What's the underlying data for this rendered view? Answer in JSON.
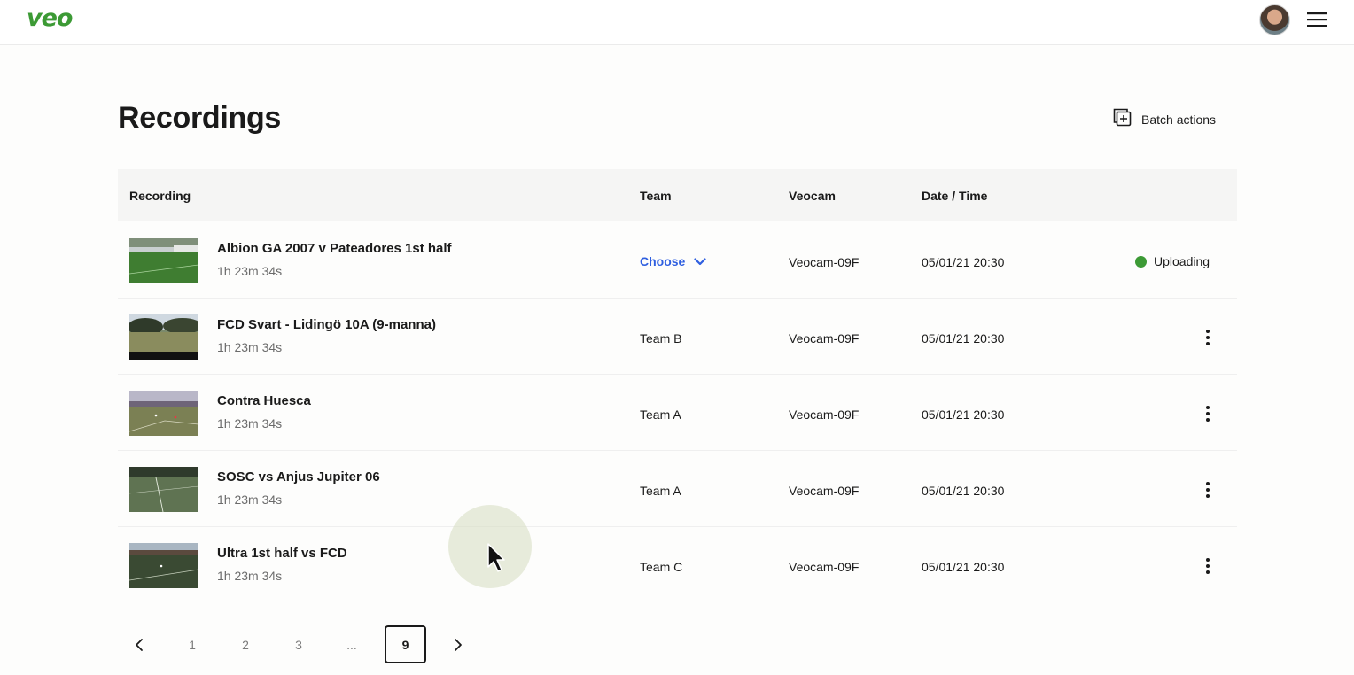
{
  "header": {
    "logo_text": "veo",
    "brand_color": "#3c9a35",
    "avatar_icon": "user-avatar",
    "menu_icon": "hamburger-menu-icon"
  },
  "page": {
    "title": "Recordings",
    "batch_actions_label": "Batch actions",
    "batch_icon": "batch-add-icon"
  },
  "table": {
    "columns": {
      "recording": "Recording",
      "team": "Team",
      "veocam": "Veocam",
      "datetime": "Date / Time"
    },
    "rows": [
      {
        "title": "Albion GA 2007 v Pateadores 1st half",
        "duration": "1h 23m 34s",
        "team": "Choose",
        "team_is_choose": true,
        "veocam": "Veocam-09F",
        "datetime": "05/01/21 20:30",
        "status": "Uploading",
        "status_color": "#3c9a35"
      },
      {
        "title": "FCD Svart - Lidingö 10A (9-manna)",
        "duration": "1h 23m 34s",
        "team": "Team B",
        "veocam": "Veocam-09F",
        "datetime": "05/01/21 20:30"
      },
      {
        "title": "Contra Huesca",
        "duration": "1h 23m 34s",
        "team": "Team A",
        "veocam": "Veocam-09F",
        "datetime": "05/01/21 20:30"
      },
      {
        "title": "SOSC vs Anjus Jupiter 06",
        "duration": "1h 23m 34s",
        "team": "Team A",
        "veocam": "Veocam-09F",
        "datetime": "05/01/21 20:30"
      },
      {
        "title": "Ultra 1st half vs FCD",
        "duration": "1h 23m 34s",
        "team": "Team C",
        "veocam": "Veocam-09F",
        "datetime": "05/01/21 20:30"
      }
    ]
  },
  "pagination": {
    "pages": [
      "1",
      "2",
      "3",
      "...",
      "9"
    ],
    "current": "9",
    "prev_icon": "chevron-left-icon",
    "next_icon": "chevron-right-icon"
  },
  "colors": {
    "link_blue": "#2f5fe0",
    "header_bg": "#f5f5f4"
  }
}
